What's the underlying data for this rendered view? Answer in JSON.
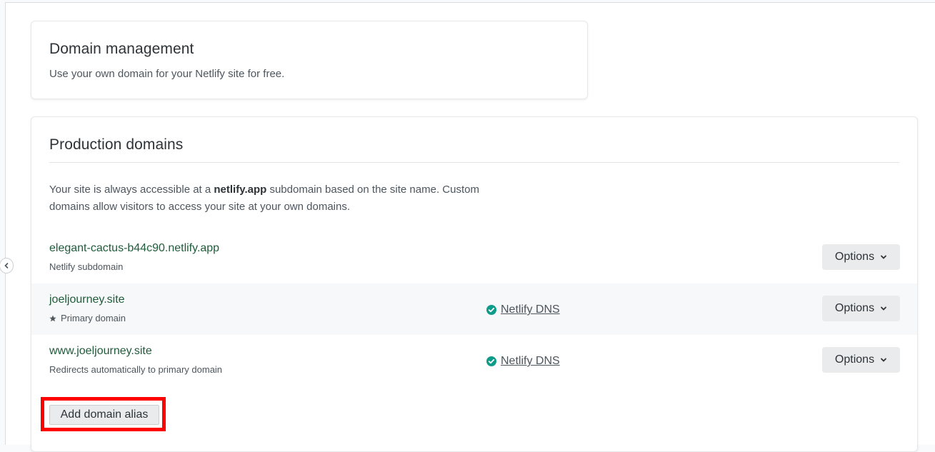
{
  "domain_card": {
    "title": "Domain management",
    "description": "Use your own domain for your Netlify site for free."
  },
  "production": {
    "title": "Production domains",
    "intro_before": "Your site is always accessible at a ",
    "intro_bold": "netlify.app",
    "intro_after": " subdomain based on the site name. Custom domains allow visitors to access your site at your own domains.",
    "rows": [
      {
        "name": "elegant-cactus-b44c90.netlify.app",
        "sub": "Netlify subdomain",
        "dns": "",
        "options": "Options"
      },
      {
        "name": "joeljourney.site",
        "sub": "Primary domain",
        "dns": "Netlify DNS",
        "options": "Options"
      },
      {
        "name": "www.joeljourney.site",
        "sub": "Redirects automatically to primary domain",
        "dns": "Netlify DNS",
        "options": "Options"
      }
    ],
    "add_alias_label": "Add domain alias"
  },
  "icons": {
    "collapse": "chevron-left-icon",
    "star": "star-icon",
    "check": "check-circle-icon",
    "chevron": "chevron-down-icon"
  },
  "colors": {
    "domain_name": "#1f5c3a",
    "check": "#0d9b8a",
    "highlight": "#ff0000"
  }
}
